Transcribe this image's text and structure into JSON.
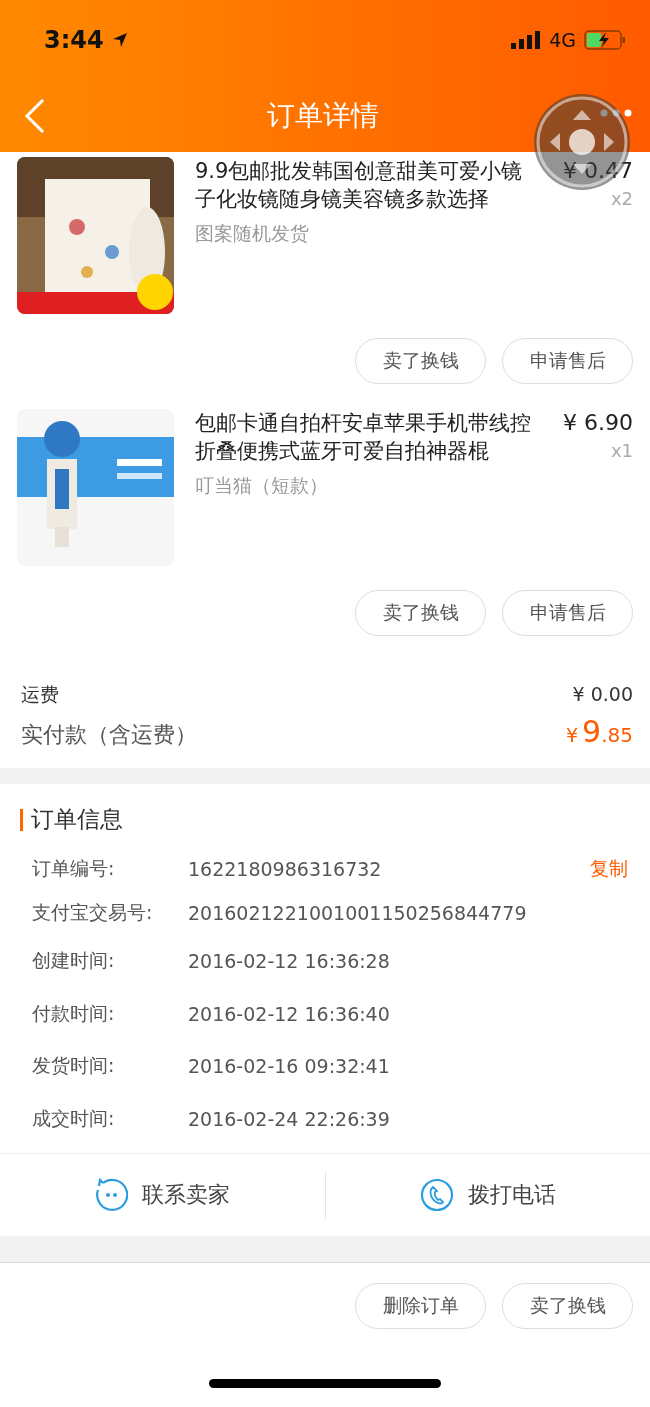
{
  "status_bar": {
    "time": "3:44",
    "network": "4G",
    "charging": true
  },
  "nav": {
    "title": "订单详情"
  },
  "items": [
    {
      "title": "9.9包邮批发韩国创意甜美可爱小镜子化妆镜随身镜美容镜多款选择",
      "price": "¥ 0.47",
      "quantity": "x2",
      "variant": "图案随机发货",
      "actions": [
        "卖了换钱",
        "申请售后"
      ]
    },
    {
      "title": "包邮卡通自拍杆安卓苹果手机带线控折叠便携式蓝牙可爱自拍神器棍",
      "price": "¥ 6.90",
      "quantity": "x1",
      "variant": "叮当猫（短款）",
      "actions": [
        "卖了换钱",
        "申请售后"
      ]
    }
  ],
  "summary": {
    "shipping_label": "运费",
    "shipping_value": "¥ 0.00",
    "total_label": "实付款（含运费）",
    "total_currency": "¥",
    "total_integer": "9",
    "total_decimal": ".85"
  },
  "order_info": {
    "title": "订单信息",
    "rows": [
      {
        "label": "订单编号:",
        "value": "1622180986316732",
        "action": "复制"
      },
      {
        "label": "支付宝交易号:",
        "value": "2016021221001001150256844779"
      },
      {
        "label": "创建时间:",
        "value": "2016-02-12 16:36:28"
      },
      {
        "label": "付款时间:",
        "value": "2016-02-12 16:36:40"
      },
      {
        "label": "发货时间:",
        "value": "2016-02-16 09:32:41"
      },
      {
        "label": "成交时间:",
        "value": "2016-02-24 22:26:39"
      }
    ]
  },
  "contact": [
    {
      "kind": "chat",
      "label": "联系卖家"
    },
    {
      "kind": "phone",
      "label": "拨打电话"
    }
  ],
  "footer_actions": [
    "删除订单",
    "卖了换钱"
  ]
}
